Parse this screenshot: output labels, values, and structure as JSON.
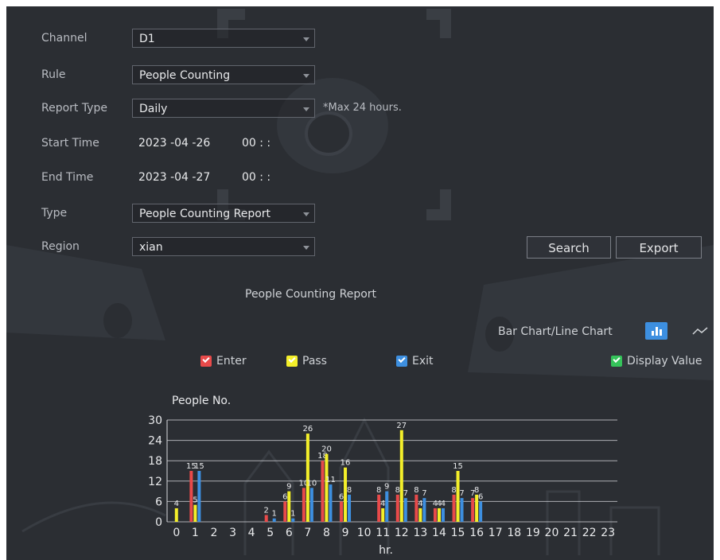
{
  "form": {
    "channel": {
      "label": "Channel",
      "value": "D1"
    },
    "rule": {
      "label": "Rule",
      "value": "People Counting"
    },
    "report_type": {
      "label": "Report Type",
      "value": "Daily",
      "hint": "*Max 24 hours."
    },
    "start_time": {
      "label": "Start Time",
      "date": "2023 -04 -26",
      "time": "00 :    :"
    },
    "end_time": {
      "label": "End Time",
      "date": "2023 -04 -27",
      "time": "00 :    :"
    },
    "type": {
      "label": "Type",
      "value": "People Counting Report"
    },
    "region": {
      "label": "Region",
      "value": "xian"
    }
  },
  "buttons": {
    "search": "Search",
    "export": "Export"
  },
  "report": {
    "title": "People Counting Report",
    "mode_label": "Bar Chart/Line Chart",
    "display_value": {
      "label": "Display Value",
      "checked": true
    }
  },
  "legend": [
    {
      "key": "enter",
      "label": "Enter",
      "color": "#e84a4a",
      "checked": true
    },
    {
      "key": "pass",
      "label": "Pass",
      "color": "#f4ef2a",
      "checked": true
    },
    {
      "key": "exit",
      "label": "Exit",
      "color": "#3d8fe0",
      "checked": true
    }
  ],
  "colors": {
    "display_value": "#35c35a",
    "active_mode": "#3d8fe0",
    "background": "#2b2e33"
  },
  "icons": {
    "bar_chart_mode": "bar-chart-icon",
    "line_chart_mode": "line-chart-icon",
    "dropdown": "chevron-down-icon"
  },
  "chart_data": {
    "type": "bar",
    "ylabel": "People No.",
    "xlabel": "hr.",
    "ylim": [
      0,
      30
    ],
    "yticks": [
      0,
      6,
      12,
      18,
      24,
      30
    ],
    "categories": [
      "0",
      "1",
      "2",
      "3",
      "4",
      "5",
      "6",
      "7",
      "8",
      "9",
      "10",
      "11",
      "12",
      "13",
      "14",
      "15",
      "16",
      "17",
      "18",
      "19",
      "20",
      "21",
      "22",
      "23"
    ],
    "grid": true,
    "series": [
      {
        "name": "Enter",
        "color": "#e84a4a",
        "values": [
          0,
          15,
          0,
          0,
          0,
          2,
          6,
          10,
          18,
          6,
          0,
          8,
          8,
          8,
          4,
          8,
          7,
          0,
          0,
          0,
          0,
          0,
          0,
          0
        ]
      },
      {
        "name": "Pass",
        "color": "#f4ef2a",
        "values": [
          4,
          5,
          0,
          0,
          0,
          0,
          9,
          26,
          20,
          16,
          0,
          4,
          27,
          4,
          4,
          15,
          8,
          0,
          0,
          0,
          0,
          0,
          0,
          0
        ]
      },
      {
        "name": "Exit",
        "color": "#3d8fe0",
        "values": [
          0,
          15,
          0,
          0,
          0,
          1,
          1,
          10,
          11,
          8,
          0,
          9,
          7,
          7,
          4,
          7,
          6,
          0,
          0,
          0,
          0,
          0,
          0,
          0
        ]
      }
    ]
  }
}
